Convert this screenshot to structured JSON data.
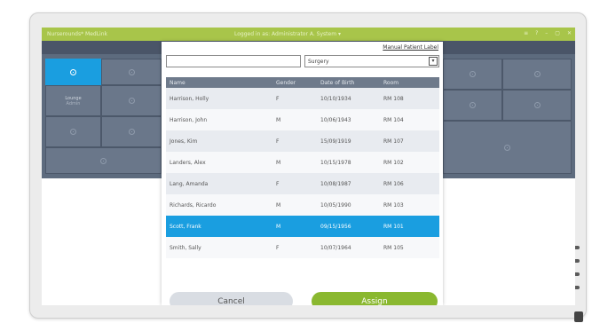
{
  "titlebar": {
    "app_name": "Nurserounds* MedLink",
    "login_text": "Logged in as: Administrator A. System ▾",
    "controls": [
      "≡",
      "?",
      "–",
      "▢",
      "✕"
    ]
  },
  "background": {
    "tiles": [
      {
        "label": "",
        "sub": ""
      },
      {
        "label": "Lounge",
        "sub": "Admin"
      }
    ]
  },
  "dialog": {
    "manual_link": "Manual Patient Label",
    "search": {
      "value": "",
      "placeholder": ""
    },
    "unit_select": {
      "value": "Surgery"
    },
    "columns": [
      "Name",
      "Gender",
      "Date of Birth",
      "Room"
    ],
    "patients": [
      {
        "name": "Harrison, Holly",
        "gender": "F",
        "dob": "10/10/1934",
        "room": "RM 108"
      },
      {
        "name": "Harrison, John",
        "gender": "M",
        "dob": "10/06/1943",
        "room": "RM 104"
      },
      {
        "name": "Jones, Kim",
        "gender": "F",
        "dob": "15/09/1919",
        "room": "RM 107"
      },
      {
        "name": "Landers, Alex",
        "gender": "M",
        "dob": "10/15/1978",
        "room": "RM 102"
      },
      {
        "name": "Lang, Amanda",
        "gender": "F",
        "dob": "10/08/1987",
        "room": "RM 106"
      },
      {
        "name": "Richards, Ricardo",
        "gender": "M",
        "dob": "10/05/1990",
        "room": "RM 103"
      },
      {
        "name": "Scott, Frank",
        "gender": "M",
        "dob": "09/15/1956",
        "room": "RM 101"
      },
      {
        "name": "Smith, Sally",
        "gender": "F",
        "dob": "10/07/1964",
        "room": "RM 105"
      }
    ],
    "selected_index": 6,
    "cancel_label": "Cancel",
    "assign_label": "Assign"
  },
  "colors": {
    "accent": "#1a9ee0",
    "brand": "#a8c54a",
    "assign": "#8ab830"
  }
}
